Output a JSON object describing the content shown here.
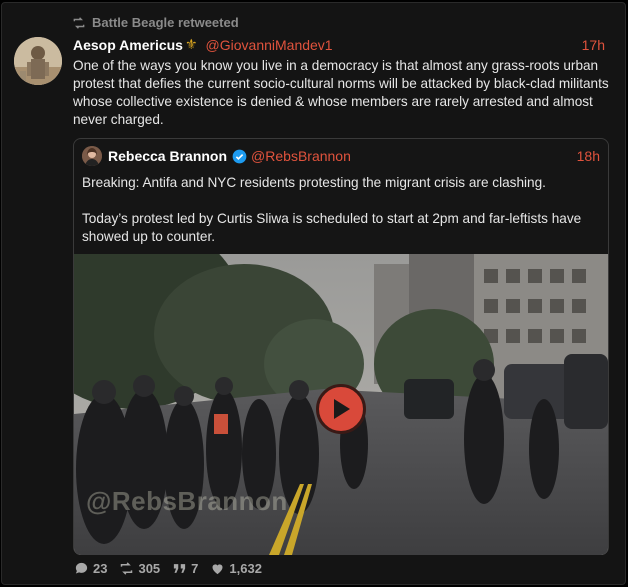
{
  "retweet": {
    "label": "Battle Beagle retweeted",
    "icon": "retweet-icon"
  },
  "author": {
    "name": "Aesop Americus",
    "emoji": "⚜",
    "handle": "@GiovanniMandev1",
    "time": "17h"
  },
  "text": "One of the ways you know you live in a democracy is that almost any grass-roots urban protest that defies the current socio-cultural norms will be attacked by black-clad militants whose collective existence is denied & whose members are rarely arrested and almost never charged.",
  "quote": {
    "name": "Rebecca Brannon",
    "handle": "@RebsBrannon",
    "time": "18h",
    "verified": true,
    "paragraphs": [
      "Breaking: Antifa and NYC residents protesting the migrant crisis are clashing.",
      "Today’s protest led by Curtis Sliwa is scheduled to start at 2pm and far-leftists have showed up to counter."
    ],
    "media": {
      "type": "video",
      "watermark": "@RebsBrannon"
    }
  },
  "actions": {
    "replies": "23",
    "retweets": "305",
    "quotes": "7",
    "likes": "1,632"
  },
  "colors": {
    "accent": "#e0533d",
    "play": "#d9493a",
    "background": "#141414"
  }
}
